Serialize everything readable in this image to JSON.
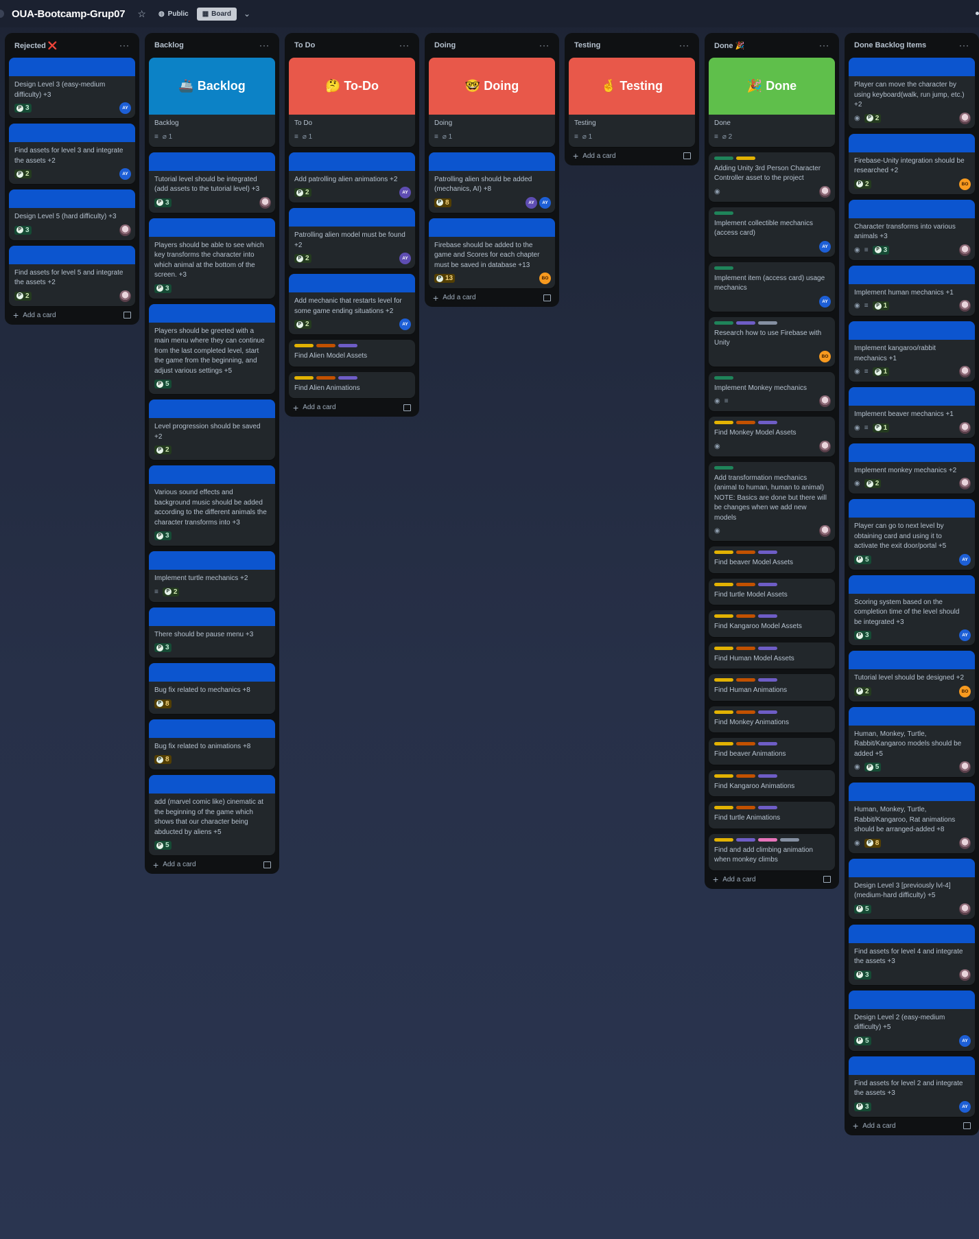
{
  "board": {
    "title": "OUA-Bootcamp-Grup07",
    "visibility": "Public",
    "view": "Board",
    "star_icon": "star-icon",
    "board_icon": "board-icon"
  },
  "add_card_label": "Add a card",
  "lists": [
    {
      "title": "Rejected ❌",
      "cards": [
        {
          "title": "Design Level 3 (easy-medium difficulty) +3",
          "points": "3",
          "members": [
            "AY"
          ]
        },
        {
          "title": "Find assets for level 3 and integrate the assets +2",
          "points": "2",
          "members": [
            "AY"
          ]
        },
        {
          "title": "Design Level 5 (hard difficulty) +3",
          "points": "3",
          "members": [
            "IMG"
          ]
        },
        {
          "title": "Find assets for level 5 and integrate the assets +2",
          "points": "2",
          "members": [
            "IMG"
          ]
        }
      ]
    },
    {
      "title": "Backlog",
      "cover": {
        "text": "🚢 Backlog",
        "color": "#0c82c6"
      },
      "header_card": {
        "title": "Backlog",
        "attachments": "1"
      },
      "cards": [
        {
          "title": "Tutorial level should be integrated (add assets to the tutorial level) +3",
          "points": "3",
          "members": [
            "IMG"
          ]
        },
        {
          "title": "Players should be able to see which key transforms the character into which animal at the bottom of the screen. +3",
          "points": "3"
        },
        {
          "title": "Players should be greeted with a main menu where they can continue from the last completed level, start the game from the beginning, and adjust various settings +5",
          "points": "5"
        },
        {
          "title": "Level progression should be saved +2",
          "points": "2"
        },
        {
          "title": "Various sound effects and background music should be added according to the different animals the character transforms into +3",
          "points": "3"
        },
        {
          "title": "Implement turtle mechanics +2",
          "points": "2",
          "desc": true
        },
        {
          "title": "There should be pause menu +3",
          "points": "3"
        },
        {
          "title": "Bug fix related to mechanics +8",
          "points": "8"
        },
        {
          "title": "Bug fix related to animations +8",
          "points": "8"
        },
        {
          "title": "add (marvel comic like) cinematic at the beginning of the game which shows that our character being abducted by aliens +5",
          "points": "5"
        }
      ]
    },
    {
      "title": "To Do",
      "cover": {
        "text": "🤔 To-Do",
        "color": "#e8584a"
      },
      "header_card": {
        "title": "To Do",
        "attachments": "1"
      },
      "cards": [
        {
          "title": "Add patrolling alien animations +2",
          "points": "2",
          "members": [
            "AY2"
          ]
        },
        {
          "title": "Patrolling alien model must be found +2",
          "points": "2",
          "members": [
            "AY2"
          ]
        },
        {
          "title": "Add mechanic that restarts level for some game ending situations +2",
          "points": "2",
          "members": [
            "AY"
          ]
        },
        {
          "title": "Find Alien Model Assets",
          "labels": [
            "#e2b203",
            "#c25100",
            "#6e5dc6"
          ],
          "nocover": true
        },
        {
          "title": "Find Alien Animations",
          "labels": [
            "#e2b203",
            "#c25100",
            "#6e5dc6"
          ],
          "nocover": true
        }
      ]
    },
    {
      "title": "Doing",
      "cover": {
        "text": "🤓 Doing",
        "color": "#e8584a"
      },
      "header_card": {
        "title": "Doing",
        "attachments": "1"
      },
      "cards": [
        {
          "title": "Patrolling alien should be added (mechanics, AI) +8",
          "points": "8",
          "members": [
            "AY2",
            "AY"
          ]
        },
        {
          "title": "Firebase should be added to the game and Scores for each chapter must be saved in database +13",
          "points": "13",
          "members": [
            "BO"
          ]
        }
      ]
    },
    {
      "title": "Testing",
      "cover": {
        "text": "🤞 Testing",
        "color": "#e8584a"
      },
      "header_card": {
        "title": "Testing",
        "attachments": "1"
      },
      "cards": []
    },
    {
      "title": "Done 🎉",
      "cover": {
        "text": "🎉 Done",
        "color": "#5fbf4b"
      },
      "header_card": {
        "title": "Done",
        "attachments": "2"
      },
      "cards": [
        {
          "title": "Adding Unity 3rd Person Character Controller asset to the project",
          "labels": [
            "#1f845a",
            "#e2b203"
          ],
          "watch": true,
          "members": [
            "IMG"
          ],
          "nocover": true
        },
        {
          "title": "Implement collectible mechanics (access card)",
          "labels": [
            "#1f845a"
          ],
          "members": [
            "AY"
          ],
          "nocover": true
        },
        {
          "title": "Implement item (access card) usage mechanics",
          "labels": [
            "#1f845a"
          ],
          "members": [
            "AY"
          ],
          "nocover": true
        },
        {
          "title": "Research how to use Firebase with Unity",
          "labels": [
            "#1f845a",
            "#6e5dc6",
            "#8590a2"
          ],
          "members": [
            "BO"
          ],
          "nocover": true
        },
        {
          "title": "Implement Monkey mechanics",
          "labels": [
            "#1f845a"
          ],
          "watch": true,
          "desc": true,
          "members": [
            "IMG"
          ],
          "nocover": true
        },
        {
          "title": "Find Monkey Model Assets",
          "labels": [
            "#e2b203",
            "#c25100",
            "#6e5dc6"
          ],
          "watch": true,
          "members": [
            "IMG"
          ],
          "nocover": true
        },
        {
          "title": "Add transformation mechanics (animal to human, human to animal) NOTE: Basics are done but there will be changes when we add new models",
          "labels": [
            "#1f845a"
          ],
          "watch": true,
          "members": [
            "IMG"
          ],
          "nocover": true
        },
        {
          "title": "Find beaver Model Assets",
          "labels": [
            "#e2b203",
            "#c25100",
            "#6e5dc6"
          ],
          "nocover": true
        },
        {
          "title": "Find turtle Model Assets",
          "labels": [
            "#e2b203",
            "#c25100",
            "#6e5dc6"
          ],
          "nocover": true
        },
        {
          "title": "Find Kangaroo Model Assets",
          "labels": [
            "#e2b203",
            "#c25100",
            "#6e5dc6"
          ],
          "nocover": true
        },
        {
          "title": "Find Human Model Assets",
          "labels": [
            "#e2b203",
            "#c25100",
            "#6e5dc6"
          ],
          "nocover": true
        },
        {
          "title": "Find Human Animations",
          "labels": [
            "#e2b203",
            "#c25100",
            "#6e5dc6"
          ],
          "nocover": true
        },
        {
          "title": "Find Monkey Animations",
          "labels": [
            "#e2b203",
            "#c25100",
            "#6e5dc6"
          ],
          "nocover": true
        },
        {
          "title": "Find beaver Animations",
          "labels": [
            "#e2b203",
            "#c25100",
            "#6e5dc6"
          ],
          "nocover": true
        },
        {
          "title": "Find Kangaroo Animations",
          "labels": [
            "#e2b203",
            "#c25100",
            "#6e5dc6"
          ],
          "nocover": true
        },
        {
          "title": "Find turtle Animations",
          "labels": [
            "#e2b203",
            "#c25100",
            "#6e5dc6"
          ],
          "nocover": true
        },
        {
          "title": "Find and add climbing animation when monkey climbs",
          "labels": [
            "#e2b203",
            "#6e5dc6",
            "#e774bb",
            "#8590a2"
          ],
          "nocover": true
        }
      ]
    },
    {
      "title": "Done Backlog Items",
      "cards": [
        {
          "title": "Player can move the character by using keyboard(walk, run jump, etc.) +2",
          "points": "2",
          "watch": true,
          "members": [
            "IMG"
          ]
        },
        {
          "title": "Firebase-Unity integration should be researched +2",
          "points": "2",
          "members": [
            "BO"
          ]
        },
        {
          "title": "Character transforms into various animals +3",
          "points": "3",
          "watch": true,
          "desc": true,
          "members": [
            "IMG"
          ]
        },
        {
          "title": "Implement human mechanics +1",
          "points": "1",
          "watch": true,
          "desc": true,
          "members": [
            "IMG"
          ]
        },
        {
          "title": "Implement kangaroo/rabbit mechanics +1",
          "points": "1",
          "watch": true,
          "desc": true,
          "members": [
            "IMG"
          ]
        },
        {
          "title": "Implement beaver mechanics +1",
          "points": "1",
          "watch": true,
          "desc": true,
          "members": [
            "IMG"
          ]
        },
        {
          "title": "Implement monkey mechanics +2",
          "points": "2",
          "watch": true,
          "members": [
            "IMG"
          ]
        },
        {
          "title": "Player can go to next level by obtaining card and using it to activate the exit door/portal +5",
          "points": "5",
          "members": [
            "AY"
          ]
        },
        {
          "title": "Scoring system based on the completion time of the level should be integrated +3",
          "points": "3",
          "members": [
            "AY"
          ]
        },
        {
          "title": "Tutorial level should be designed +2",
          "points": "2",
          "members": [
            "BO"
          ]
        },
        {
          "title": "Human, Monkey, Turtle, Rabbit/Kangaroo models should be added +5",
          "points": "5",
          "watch": true,
          "members": [
            "IMG"
          ]
        },
        {
          "title": "Human, Monkey, Turtle, Rabbit/Kangaroo, Rat animations should be arranged-added +8",
          "points": "8",
          "watch": true,
          "members": [
            "IMG"
          ]
        },
        {
          "title": "Design Level 3 [previously lvl-4] (medium-hard difficulty) +5",
          "points": "5",
          "members": [
            "IMG"
          ]
        },
        {
          "title": "Find assets for level 4 and integrate the assets +3",
          "points": "3",
          "members": [
            "IMG"
          ]
        },
        {
          "title": "Design Level 2 (easy-medium difficulty) +5",
          "points": "5",
          "members": [
            "AY"
          ]
        },
        {
          "title": "Find assets for level 2 and integrate the assets +3",
          "points": "3",
          "members": [
            "AY"
          ]
        }
      ]
    }
  ]
}
